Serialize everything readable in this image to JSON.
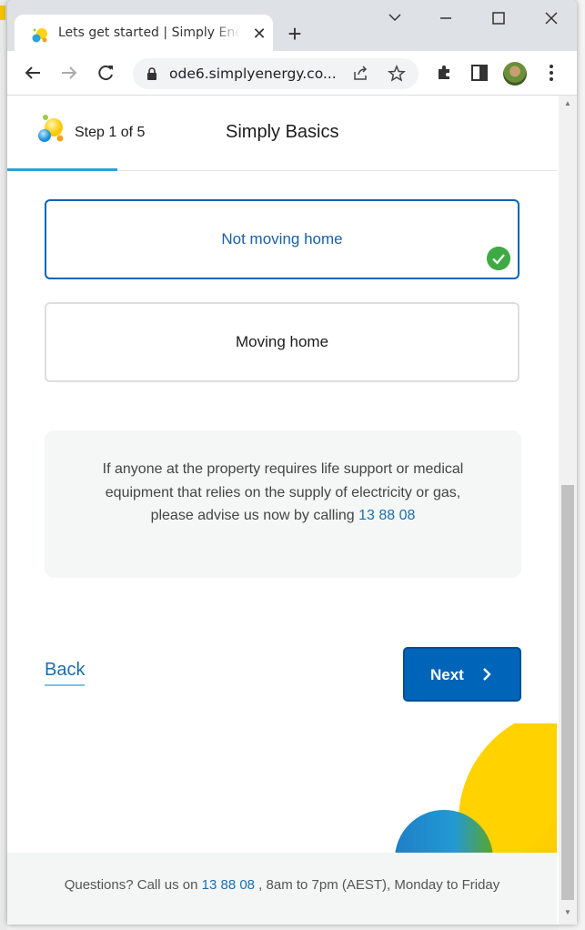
{
  "browser": {
    "tab_title": "Lets get started | Simply Energy",
    "url": "ode6.simplyenergy.co...",
    "new_tab_symbol": "+",
    "close_symbol": "✕"
  },
  "header": {
    "step_label": "Step 1 of 5",
    "page_title": "Simply Basics",
    "progress_fraction": 0.2
  },
  "options": [
    {
      "label": "Not moving home",
      "selected": true
    },
    {
      "label": "Moving home",
      "selected": false
    }
  ],
  "info": {
    "text": "If anyone at the property requires life support or medical equipment that relies on the supply of electricity or gas, please advise us now by calling ",
    "phone": "13 88 08"
  },
  "nav": {
    "back_label": "Back",
    "next_label": "Next"
  },
  "footer": {
    "prefix": "Questions? Call us on ",
    "phone": "13 88 08",
    "suffix": " , 8am to 7pm (AEST), Monday to Friday"
  },
  "colors": {
    "brand_blue": "#0065b8",
    "selected_border": "#0066b3",
    "check_green": "#3faa45",
    "progress": "#2aa3d6"
  },
  "icons": [
    "simply-energy-logo-icon",
    "close-icon",
    "plus-icon",
    "back-arrow-icon",
    "forward-arrow-icon",
    "reload-icon",
    "lock-icon",
    "share-icon",
    "star-icon",
    "extensions-icon",
    "sidepanel-icon",
    "kebab-menu-icon",
    "check-icon",
    "chevron-right-icon"
  ]
}
